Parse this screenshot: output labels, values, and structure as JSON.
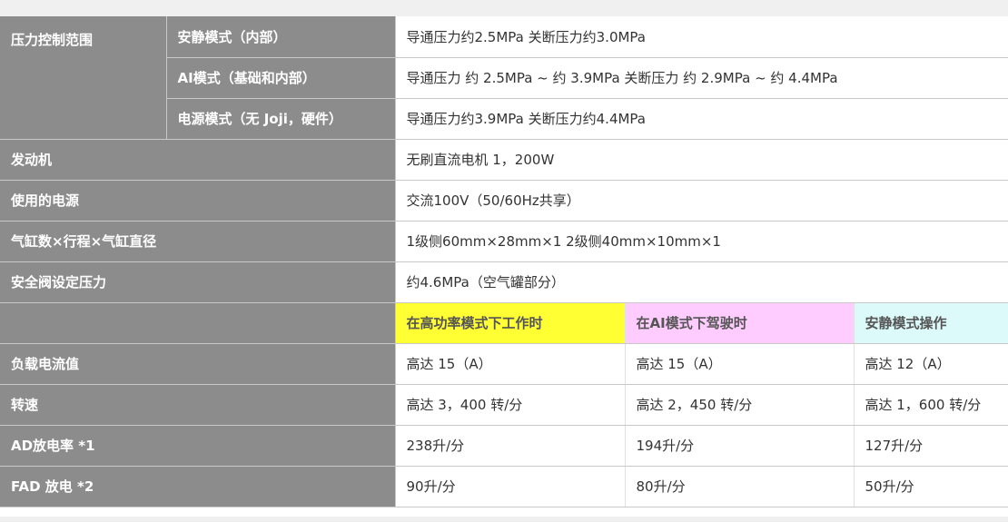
{
  "pressure": {
    "label": "压力控制范围",
    "rows": [
      {
        "mode": "安静模式（内部）",
        "value": "导通压力约2.5MPa 关断压力约3.0MPa"
      },
      {
        "mode": "AI模式（基础和内部）",
        "value": "导通压力 约 2.5MPa ~ 约 3.9MPa 关断压力 约 2.9MPa ~ 约 4.4MPa"
      },
      {
        "mode": "电源模式（无 Joji，硬件）",
        "value": "导通压力约3.9MPa 关断压力约4.4MPa"
      }
    ]
  },
  "specs": [
    {
      "label": "发动机",
      "value": "无刷直流电机 1，200W"
    },
    {
      "label": "使用的电源",
      "value": "交流100V（50/60Hz共享）"
    },
    {
      "label": "气缸数×行程×气缸直径",
      "value": "1级侧60mm×28mm×1 2级侧40mm×10mm×1"
    },
    {
      "label": "安全阀设定压力",
      "value": "约4.6MPa（空气罐部分）"
    }
  ],
  "modes": {
    "high_power": "在高功率模式下工作时",
    "ai": "在AI模式下驾驶时",
    "quiet": "安静模式操作",
    "colors": {
      "high_power": "#ffff33",
      "ai": "#ffccff",
      "quiet": "#ddfafa"
    }
  },
  "perf": [
    {
      "label": "负载电流值",
      "high_power": "高达 15（A）",
      "ai": "高达 15（A）",
      "quiet": "高达 12（A）"
    },
    {
      "label": "转速",
      "high_power": "高达 3，400 转/分",
      "ai": "高达 2，450 转/分",
      "quiet": "高达 1，600 转/分"
    },
    {
      "label": "AD放电率 *1",
      "high_power": "238升/分",
      "ai": "194升/分",
      "quiet": "127升/分"
    },
    {
      "label": "FAD 放电 *2",
      "high_power": "90升/分",
      "ai": "80升/分",
      "quiet": "50升/分"
    }
  ]
}
